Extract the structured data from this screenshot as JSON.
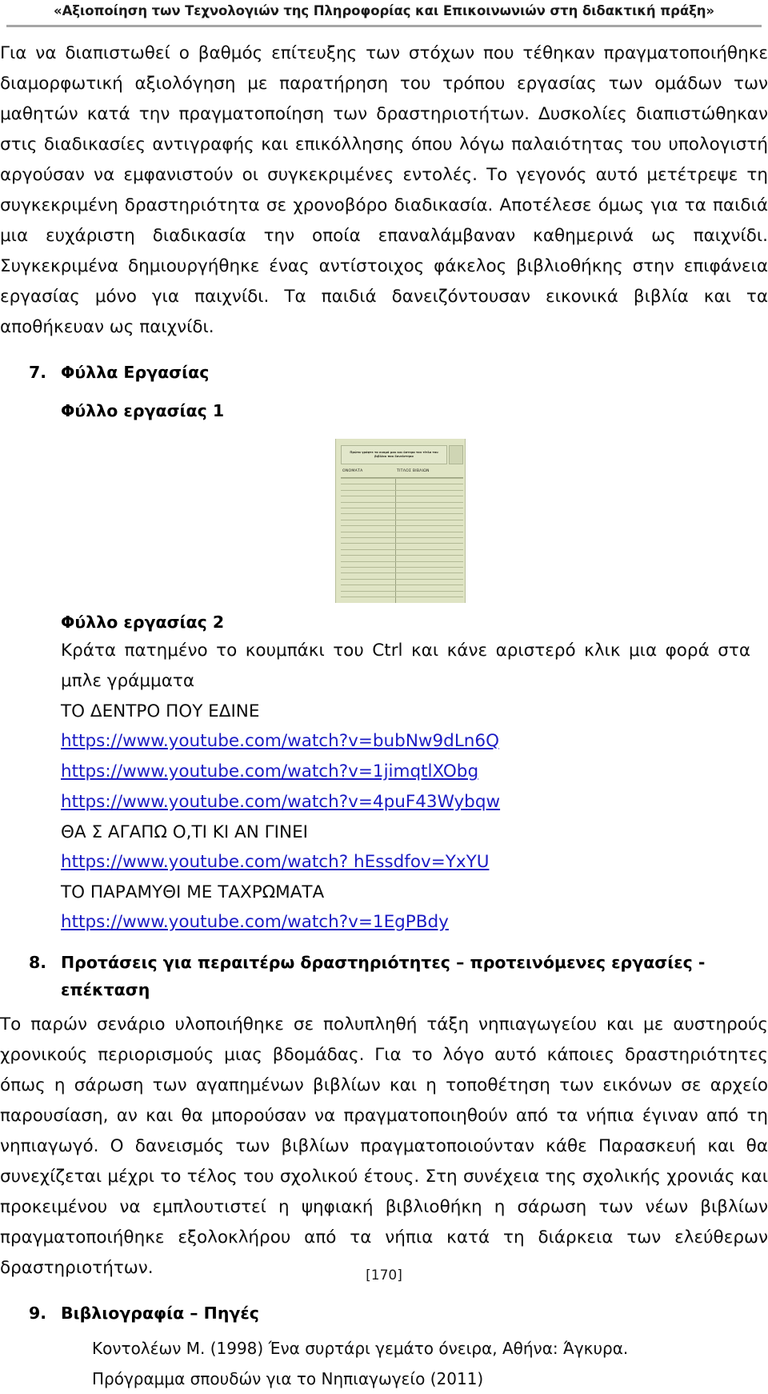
{
  "header": {
    "title": "«Αξιοποίηση των Τεχνολογιών της Πληροφορίας και Επικοινωνιών στη διδακτική πράξη»"
  },
  "body": {
    "paragraph_1": "Για να διαπιστωθεί ο βαθμός επίτευξης των στόχων που τέθηκαν πραγματοποιήθηκε διαμορφωτική αξιολόγηση  με παρατήρηση του τρόπου εργασίας των ομάδων των μαθητών κατά την πραγματοποίηση των δραστηριοτήτων. Δυσκολίες διαπιστώθηκαν στις διαδικασίες αντιγραφής και επικόλλησης όπου λόγω παλαιότητας του υπολογιστή αργούσαν να εμφανιστούν οι συγκεκριμένες εντολές. Το γεγονός αυτό μετέτρεψε τη συγκεκριμένη δραστηριότητα σε χρονοβόρο διαδικασία. Αποτέλεσε όμως για τα παιδιά μια ευχάριστη διαδικασία την οποία επαναλάμβαναν καθημερινά ως παιχνίδι. Συγκεκριμένα δημιουργήθηκε ένας αντίστοιχος φάκελος βιβλιοθήκης στην επιφάνεια εργασίας μόνο για παιχνίδι. Τα παιδιά δανειζόντουσαν εικονικά βιβλία και τα αποθήκευαν ως παιχνίδι."
  },
  "sections": [
    {
      "number": "7.",
      "title": "Φύλλα Εργασίας"
    },
    {
      "number": "8.",
      "title": "Προτάσεις για περαιτέρω δραστηριότητες – προτεινόμενες εργασίες - επέκταση"
    },
    {
      "number": "9.",
      "title": "Βιβλιογραφία – Πηγές"
    }
  ],
  "worksheet_1": {
    "heading": "Φύλλο εργασίας 1",
    "image": {
      "title_text": "Πρώτα γράψτε τα ονομά μου και ύστερα τον τίτλο του βιβλίου που δανείστηκα",
      "columns": [
        "ΟΝΟΜΑΤΑ",
        "ΤΙΤΛΟΣ  ΒΙΒΛΙΩΝ"
      ],
      "row_count": 21,
      "paper_color": "#dfe4c4",
      "rule_color": "#b2b995"
    }
  },
  "worksheet_2": {
    "heading": "Φύλλο εργασίας 2",
    "instruction": "Κράτα πατημένο το κουμπάκι του Ctrl και κάνε αριστερό κλικ μια φορά στα μπλε γράμματα",
    "link_color": "#1b1bc4",
    "entries": [
      {
        "label": "ΤΟ ΔΕΝΤΡΟ ΠΟΥ ΕΔΙΝΕ",
        "urls": [
          "https://www.youtube.com/watch?v=bubNw9dLn6Q",
          "https://www.youtube.com/watch?v=1jimqtlXObg",
          "https://www.youtube.com/watch?v=4puF43Wybqw"
        ]
      },
      {
        "label": "ΘΑ Σ ΑΓΑΠΩ Ο,ΤΙ ΚΙ ΑΝ ΓΙΝΕΙ",
        "urls": [
          "https://www.youtube.com/watch? hEssdfov=YxYU"
        ]
      },
      {
        "label": "ΤΟ ΠΑΡΑΜΥΘΙ ΜΕ ΤΑΧΡΩΜΑΤΑ",
        "urls": [
          "https://www.youtube.com/watch?v=1EgPBdy"
        ]
      }
    ]
  },
  "section_8_body": "Το παρών σενάριο υλοποιήθηκε σε πολυπληθή τάξη νηπιαγωγείου και με αυστηρούς χρονικούς περιορισμούς μιας βδομάδας. Για το λόγο αυτό κάποιες δραστηριότητες όπως η σάρωση των αγαπημένων βιβλίων και η τοποθέτηση των εικόνων σε αρχείο παρουσίαση, αν και θα μπορούσαν να πραγματοποιηθούν από τα νήπια  έγιναν από τη νηπιαγωγό. Ο δανεισμός των βιβλίων πραγματοποιούνταν κάθε Παρασκευή  και θα συνεχίζεται μέχρι το τέλος του σχολικού έτους. Στη συνέχεια της σχολικής χρονιάς  και προκειμένου να εμπλουτιστεί η ψηφιακή βιβλιοθήκη  η σάρωση των νέων βιβλίων πραγματοποιήθηκε εξολοκλήρου από τα νήπια κατά τη διάρκεια των ελεύθερων δραστηριοτήτων.",
  "bibliography": [
    "Κοντολέων Μ. (1998) Ένα συρτάρι γεμάτο όνειρα, Αθήνα: Άγκυρα.",
    "Πρόγραμμα σπουδών για το Νηπιαγωγείο (2011)"
  ],
  "footer": {
    "page_number": "[170]"
  }
}
